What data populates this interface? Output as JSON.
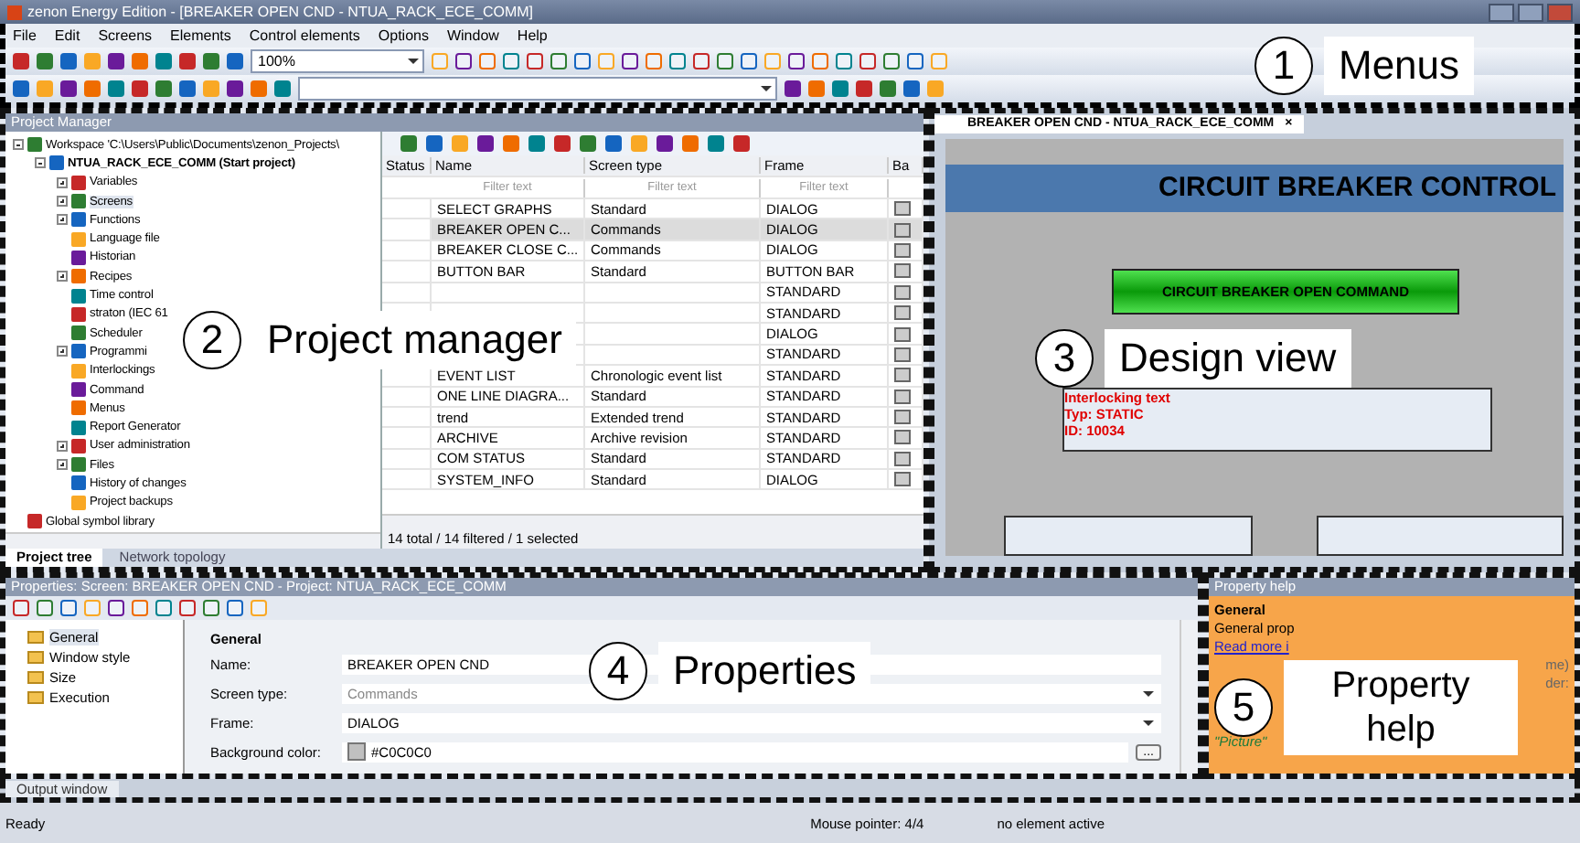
{
  "window": {
    "title": "zenon Energy Edition - [BREAKER OPEN CND - NTUA_RACK_ECE_COMM]"
  },
  "menu": [
    "File",
    "Edit",
    "Screens",
    "Elements",
    "Control elements",
    "Options",
    "Window",
    "Help"
  ],
  "toolbar": {
    "zoom": "100%"
  },
  "project_manager": {
    "title": "Project Manager",
    "tree": {
      "label": "Workspace 'C:\\Users\\Public\\Documents\\zenon_Projects\\",
      "children": [
        {
          "label": "NTUA_RACK_ECE_COMM (Start project)",
          "children": [
            {
              "label": "Variables",
              "expandable": true,
              "selected": false
            },
            {
              "label": "Screens",
              "expandable": true,
              "selected": true
            },
            {
              "label": "Functions",
              "expandable": true,
              "selected": false
            },
            {
              "label": "Language file",
              "expandable": false,
              "selected": false
            },
            {
              "label": "Historian",
              "expandable": false,
              "selected": false
            },
            {
              "label": "Recipes",
              "expandable": true,
              "selected": false
            },
            {
              "label": "Time control",
              "expandable": false,
              "selected": false
            },
            {
              "label": "straton (IEC 61",
              "expandable": false,
              "selected": false
            },
            {
              "label": "Scheduler",
              "expandable": false,
              "selected": false
            },
            {
              "label": "Programmi",
              "expandable": true,
              "selected": false
            },
            {
              "label": "Interlockings",
              "expandable": false,
              "selected": false
            },
            {
              "label": "Command",
              "expandable": false,
              "selected": false
            },
            {
              "label": "Menus",
              "expandable": false,
              "selected": false
            },
            {
              "label": "Report Generator",
              "expandable": false,
              "selected": false
            },
            {
              "label": "User administration",
              "expandable": true,
              "selected": false
            },
            {
              "label": "Files",
              "expandable": true,
              "selected": false
            },
            {
              "label": "History of changes",
              "expandable": false,
              "selected": false
            },
            {
              "label": "Project backups",
              "expandable": false,
              "selected": false
            }
          ]
        },
        {
          "label": "Global symbol library"
        }
      ]
    },
    "table": {
      "columns": [
        "Status",
        "Name",
        "Screen type",
        "Frame",
        "Ba"
      ],
      "filter_placeholder": [
        "Filter text",
        "Filter text",
        "Filter text"
      ],
      "rows": [
        {
          "name": "SELECT GRAPHS",
          "type": "Standard",
          "frame": "DIALOG",
          "selected": false
        },
        {
          "name": "BREAKER OPEN C...",
          "type": "Commands",
          "frame": "DIALOG",
          "selected": true
        },
        {
          "name": "BREAKER CLOSE C...",
          "type": "Commands",
          "frame": "DIALOG",
          "selected": false
        },
        {
          "name": "BUTTON BAR",
          "type": "Standard",
          "frame": "BUTTON BAR",
          "selected": false
        },
        {
          "frame": "STANDARD",
          "selected": false
        },
        {
          "frame": "STANDARD",
          "selected": false
        },
        {
          "frame": "DIALOG",
          "selected": false
        },
        {
          "frame": "STANDARD",
          "selected": false
        },
        {
          "name": "EVENT LIST",
          "type": "Chronologic event list",
          "frame": "STANDARD",
          "selected": false
        },
        {
          "name": "ONE LINE DIAGRA...",
          "type": "Standard",
          "frame": "STANDARD",
          "selected": false
        },
        {
          "name": "trend",
          "type": "Extended trend",
          "frame": "STANDARD",
          "selected": false
        },
        {
          "name": "ARCHIVE",
          "type": "Archive revision",
          "frame": "STANDARD",
          "selected": false
        },
        {
          "name": "COM STATUS",
          "type": "Standard",
          "frame": "STANDARD",
          "selected": false
        },
        {
          "name": "SYSTEM_INFO",
          "type": "Standard",
          "frame": "DIALOG",
          "selected": false
        }
      ],
      "footer": "14 total / 14 filtered / 1 selected"
    },
    "tabs": [
      {
        "label": "Project tree",
        "selected": true
      },
      {
        "label": "Network topology",
        "selected": false
      }
    ]
  },
  "design_view": {
    "tab": "BREAKER OPEN CND - NTUA_RACK_ECE_COMM",
    "close": "×",
    "header": "CIRCUIT BREAKER CONTROL",
    "button": "CIRCUIT BREAKER OPEN COMMAND",
    "interlock_lines": [
      "Interlocking text",
      "Typ: STATIC",
      "ID: 10034"
    ]
  },
  "properties": {
    "title": "Properties: Screen: BREAKER OPEN CND - Project: NTUA_RACK_ECE_COMM",
    "tree": [
      {
        "label": "General",
        "selected": true
      },
      {
        "label": "Window style",
        "selected": false
      },
      {
        "label": "Size",
        "selected": false
      },
      {
        "label": "Execution",
        "selected": false
      }
    ],
    "group": "General",
    "fields": [
      {
        "kind": "text",
        "label": "Name:",
        "value": "BREAKER OPEN CND",
        "disabled": false
      },
      {
        "kind": "dropdown",
        "label": "Screen type:",
        "value": "Commands",
        "disabled": true
      },
      {
        "kind": "dropdown",
        "label": "Frame:",
        "value": "DIALOG",
        "disabled": false
      },
      {
        "kind": "color",
        "label": "Background color:",
        "value": "#C0C0C0",
        "color": "#c0c0c0",
        "disabled": false,
        "button": "..."
      }
    ]
  },
  "property_help": {
    "title": "Property help",
    "heading": "General",
    "text": "General prop",
    "link": "Read more i",
    "fragments": [
      "me)",
      "der:"
    ],
    "quote": "\"Picture\""
  },
  "output_tab": "Output window",
  "status_bar": [
    "Ready",
    "Mouse pointer: 4/4",
    "no element active"
  ],
  "annotations": [
    {
      "number": "1",
      "label": "Menus"
    },
    {
      "number": "2",
      "label": "Project manager"
    },
    {
      "number": "3",
      "label": "Design view"
    },
    {
      "number": "4",
      "label": "Properties"
    },
    {
      "number": "5",
      "label": "Property help"
    }
  ]
}
